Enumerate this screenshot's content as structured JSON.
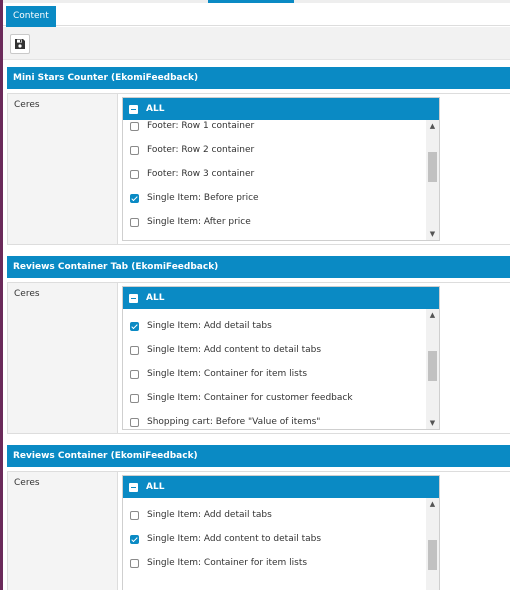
{
  "tabs": {
    "content": "Content"
  },
  "toolbar": {
    "save_icon": "floppy-disk-icon"
  },
  "sections": [
    {
      "title": "Mini Stars Counter (EkomiFeedback)",
      "label": "Ceres",
      "all_label": "ALL",
      "items": [
        {
          "label": "Footer: Row 1 container",
          "checked": false
        },
        {
          "label": "Footer: Row 2 container",
          "checked": false
        },
        {
          "label": "Footer: Row 3 container",
          "checked": false
        },
        {
          "label": "Single Item: Before price",
          "checked": true
        },
        {
          "label": "Single Item: After price",
          "checked": false
        }
      ]
    },
    {
      "title": "Reviews Container Tab (EkomiFeedback)",
      "label": "Ceres",
      "all_label": "ALL",
      "items": [
        {
          "label": "Single Item: Add detail tabs",
          "checked": true
        },
        {
          "label": "Single Item: Add content to detail tabs",
          "checked": false
        },
        {
          "label": "Single Item: Container for item lists",
          "checked": false
        },
        {
          "label": "Single Item: Container for customer feedback",
          "checked": false
        },
        {
          "label": "Shopping cart: Before \"Value of items\"",
          "checked": false
        }
      ]
    },
    {
      "title": "Reviews Container (EkomiFeedback)",
      "label": "Ceres",
      "all_label": "ALL",
      "items": [
        {
          "label": "Single Item: Add detail tabs",
          "checked": false
        },
        {
          "label": "Single Item: Add content to detail tabs",
          "checked": true
        },
        {
          "label": "Single Item: Container for item lists",
          "checked": false
        }
      ]
    }
  ]
}
